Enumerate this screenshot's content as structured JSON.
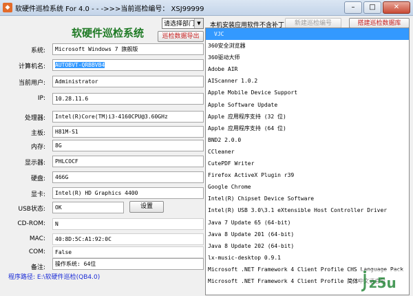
{
  "window": {
    "title": "软硬件巡检系统 For 4.0 - - ->>>当前巡检编号： XSJ99999",
    "min_label": "–",
    "max_label": "□",
    "close_label": "✕"
  },
  "header": {
    "app_title": "软硬件巡检系统",
    "dept_select_value": "请选择部门",
    "export_button": "巡检数据导出"
  },
  "fields": [
    {
      "label": "系统:",
      "value": "Microsoft Windows 7 旗舰版"
    },
    {
      "label": "计算机名:",
      "value": "AUTOBVT-QRBBVB4"
    },
    {
      "label": "当前用户:",
      "value": "Administrator"
    },
    {
      "label": "IP:",
      "value": "10.28.11.6"
    },
    {
      "label": "处理器:",
      "value": "Intel(R)Core(TM)i3-4160CPU@3.60GHz"
    },
    {
      "label": "主板:",
      "value": "H81M-S1"
    },
    {
      "label": "内存:",
      "value": "8G"
    },
    {
      "label": "显示器:",
      "value": "PHLCOCF"
    },
    {
      "label": "硬盘:",
      "value": "466G"
    },
    {
      "label": "显卡:",
      "value": "Intel(R) HD Graphics 4400"
    },
    {
      "label": "USB状态:",
      "value": "OK"
    },
    {
      "label": "CD-ROM:",
      "value": "N"
    },
    {
      "label": "MAC:",
      "value": "40:8D:5C:A1:92:0C"
    },
    {
      "label": "COM:",
      "value": "False"
    },
    {
      "label": "备注:",
      "value": "操作系统: 64位"
    }
  ],
  "usb_settings_button": "设置",
  "program_path": "程序路径: E:\\软硬件巡检(QB4.0)",
  "software_panel": {
    "header": "本机安装应用软件不含补丁",
    "new_id_button": "新建巡检编号",
    "build_db_button": "搭建巡检数据库",
    "items": [
      "VJC",
      "360安全浏览器",
      "360驱动大师",
      "Adobe AIR",
      "AIScanner 1.0.2",
      "Apple Mobile Device Support",
      "Apple Software Update",
      "Apple 应用程序支持 (32 位)",
      "Apple 应用程序支持 (64 位)",
      "BND2 2.0.0",
      "CCleaner",
      "CutePDF Writer",
      "Firefox ActiveX Plugin r39",
      "Google Chrome",
      "Intel(R) Chipset Device Software",
      "Intel(R) USB 3.0\\3.1 eXtensible Host Controller Driver",
      "Java 7 Update 65 (64-bit)",
      "Java 8 Update 201 (64-bit)",
      "Java 8 Update 202 (64-bit)",
      "lx-music-desktop 0.9.1",
      "Microsoft .NET Framework 4 Client Profile CHS Language Pack",
      "Microsoft .NET Framework 4 Client Profile 简体中文语言包"
    ]
  },
  "watermark_text": "jz5u"
}
